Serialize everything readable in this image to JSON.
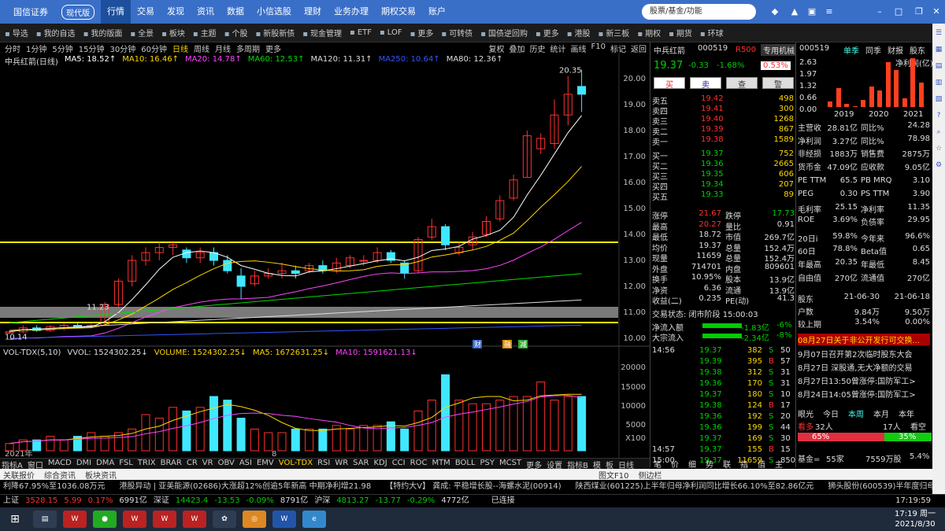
{
  "titlebar": {
    "logo": "国信证券",
    "edition": "现代版",
    "tabs": [
      "行情",
      "交易",
      "发现",
      "资讯",
      "数据",
      "小信选股",
      "理财",
      "业务办理",
      "期权交易",
      "账户"
    ],
    "search_placeholder": "股票/基金/功能"
  },
  "toolbar": [
    "导选",
    "我的自选",
    "我的版面",
    "全景",
    "板块",
    "主题",
    "个股",
    "新股新债",
    "现金管理",
    "ETF",
    "LOF",
    "更多",
    "可转债",
    "国债逆回购",
    "更多",
    "港股",
    "新三板",
    "期权",
    "期货",
    "环球"
  ],
  "periods": [
    "分时",
    "1分钟",
    "5分钟",
    "15分钟",
    "30分钟",
    "60分钟",
    "日线",
    "周线",
    "月线",
    "多周期",
    "更多"
  ],
  "chart_controls": [
    "复权",
    "叠加",
    "历史",
    "统计",
    "画线",
    "F10",
    "标记",
    "返回"
  ],
  "chart_title": "中兵红箭(日线)",
  "ma": [
    {
      "label": "MA5: 18.52↑",
      "color": "#ffffff"
    },
    {
      "label": "MA10: 16.46↑",
      "color": "#ffd700"
    },
    {
      "label": "MA20: 14.78↑",
      "color": "#ff44ff"
    },
    {
      "label": "MA60: 12.53↑",
      "color": "#00dd00"
    },
    {
      "label": "MA120: 11.31↑",
      "color": "#dddddd"
    },
    {
      "label": "MA250: 10.64↑",
      "color": "#3355ff"
    },
    {
      "label": "MA80: 12.36↑",
      "color": "#dddddd"
    }
  ],
  "vol": [
    {
      "label": "VOL-TDX(5,10)",
      "color": "#dddddd"
    },
    {
      "label": "VVOL: 1524302.25↓",
      "color": "#dddddd"
    },
    {
      "label": "VOLUME: 1524302.25↓",
      "color": "#ffd700"
    },
    {
      "label": "MA5: 1672631.25↓",
      "color": "#ffd700"
    },
    {
      "label": "MA10: 1591621.13↓",
      "color": "#ff44ff"
    }
  ],
  "price_axis": [
    "20.00",
    "19.00",
    "18.00",
    "17.00",
    "16.00",
    "15.00",
    "14.00",
    "13.00",
    "12.00",
    "11.00",
    "10.00"
  ],
  "vol_axis": [
    "20000",
    "15000",
    "10000",
    "5000",
    "X100"
  ],
  "annotations": {
    "high": "20.35",
    "low": "10.14",
    "mid": "11.23",
    "year": "2021年",
    "month": "8",
    "badges": [
      "财",
      "融",
      "减"
    ]
  },
  "indicators": [
    "指标A",
    "窗口",
    "MACD",
    "DMI",
    "DMA",
    "FSL",
    "TRIX",
    "BRAR",
    "CR",
    "VR",
    "OBV",
    "ASI",
    "EMV",
    "VOL-TDX",
    "RSI",
    "WR",
    "SAR",
    "KDJ",
    "CCI",
    "ROC",
    "MTM",
    "BOLL",
    "PSY",
    "MCST",
    "更多",
    "设置",
    "指标B",
    "模",
    "板",
    "日线"
  ],
  "quote": {
    "name": "中兵红箭",
    "code": "000519",
    "badge": "R500",
    "tag": "专用机械",
    "price": "19.37",
    "change": "-0.33",
    "pct": "-1.68%",
    "pct_box": "0.53%",
    "actions": [
      "买",
      "卖",
      "查",
      "警"
    ],
    "asks": [
      [
        "卖五",
        "19.42",
        "498"
      ],
      [
        "卖四",
        "19.41",
        "300"
      ],
      [
        "卖三",
        "19.40",
        "1268"
      ],
      [
        "卖二",
        "19.39",
        "867"
      ],
      [
        "卖一",
        "19.38",
        "1589"
      ]
    ],
    "bids": [
      [
        "买一",
        "19.37",
        "752"
      ],
      [
        "买二",
        "19.36",
        "2665"
      ],
      [
        "买三",
        "19.35",
        "606"
      ],
      [
        "买四",
        "19.34",
        "207"
      ],
      [
        "买五",
        "19.33",
        "89"
      ]
    ],
    "stats": [
      [
        "涨停",
        "21.67",
        "跌停",
        "17.73"
      ],
      [
        "最高",
        "20.27",
        "量比",
        "0.91"
      ],
      [
        "最低",
        "18.72",
        "市值",
        "269.7亿"
      ],
      [
        "均价",
        "19.37",
        "总量",
        "152.4万"
      ],
      [
        "现量",
        "11659",
        "总量",
        "152.4万"
      ],
      [
        "外盘",
        "714701",
        "内盘",
        "809601"
      ],
      [
        "换手",
        "10.95%",
        "股本",
        "13.9亿"
      ],
      [
        "净资",
        "6.36",
        "流通",
        "13.9亿"
      ],
      [
        "收益(二)",
        "0.235",
        "PE(动)",
        "41.3"
      ]
    ],
    "trade_status": "交易状态: 闭市阶段 15:00:03",
    "flows": [
      [
        "净流入额",
        "-1.83亿",
        "-6%"
      ],
      [
        "大宗流入",
        "-2.34亿",
        "-8%"
      ]
    ],
    "ticks": [
      [
        "14:56",
        "19.37",
        "382",
        "S",
        "50"
      ],
      [
        "",
        "19.39",
        "395",
        "B",
        "57"
      ],
      [
        "",
        "19.38",
        "312",
        "S",
        "31"
      ],
      [
        "",
        "19.36",
        "170",
        "S",
        "31"
      ],
      [
        "",
        "19.37",
        "180",
        "S",
        "10"
      ],
      [
        "",
        "19.38",
        "124",
        "B",
        "17"
      ],
      [
        "",
        "19.36",
        "192",
        "S",
        "20"
      ],
      [
        "",
        "19.36",
        "199",
        "S",
        "44"
      ],
      [
        "",
        "19.37",
        "169",
        "S",
        "30"
      ],
      [
        "14:57",
        "19.37",
        "155",
        "B",
        "15"
      ],
      [
        "15:00",
        "19.37",
        "11659",
        "S",
        "850"
      ]
    ],
    "tabs": [
      "笔",
      "价",
      "细",
      "势",
      "联",
      "指",
      "值",
      "主"
    ]
  },
  "fin": {
    "code": "000519",
    "tabs": [
      "单季",
      "同季",
      "财报",
      "股东"
    ],
    "chart_title": "净利润(亿)",
    "axis": [
      "2.63",
      "1.97",
      "1.32",
      "0.66",
      "0.00"
    ],
    "years": [
      "2019",
      "2020",
      "2021"
    ],
    "bars": [
      0.3,
      1.0,
      0.15,
      0.05,
      0.4,
      1.1,
      0.9,
      2.4,
      2.0,
      0.45,
      2.63,
      1.3
    ],
    "rows": [
      [
        "主营收",
        "28.81亿",
        "同比%",
        "24.28"
      ],
      [
        "净利润",
        "3.27亿",
        "同比%",
        "78.98"
      ],
      [
        "非经损",
        "1883万",
        "销售费",
        "2875万"
      ],
      [
        "货币金",
        "47.09亿",
        "应收款",
        "9.05亿"
      ],
      [
        "PE TTM",
        "65.5",
        "PB MRQ",
        "3.10"
      ],
      [
        "PEG",
        "0.30",
        "PS TTM",
        "3.90"
      ],
      [
        "毛利率",
        "25.15",
        "净利率",
        "11.35"
      ],
      [
        "ROE",
        "3.69%",
        "负债率",
        "29.95"
      ],
      [
        "20日i",
        "59.8%",
        "今年来",
        "96.6%"
      ],
      [
        "60日",
        "78.8%",
        "Beta值",
        "0.65"
      ],
      [
        "年最高",
        "20.35",
        "年最低",
        "8.45"
      ],
      [
        "自由值",
        "270亿",
        "流通值",
        "270亿"
      ]
    ],
    "holders": [
      [
        "股东",
        "21-06-30",
        "21-06-18"
      ],
      [
        "户数",
        "9.84万",
        "9.50万"
      ],
      [
        "较上期",
        "3.54%",
        "0.00%"
      ]
    ],
    "news_header": "08月27日关于非公开发行可交换...",
    "news": [
      "9月07日召开第2次临时股东大会",
      "8月27日 深股通,无大净额的交易",
      "8月27日13:50曾涨停:国防军工>",
      "8月24日14:05曾涨停:国防军工>"
    ],
    "sentiment_tabs": [
      "眼光",
      "今日",
      "本周",
      "本月",
      "本年"
    ],
    "sentiment_labels": [
      "看多",
      "32人",
      "17人",
      "看空"
    ],
    "bull": "65%",
    "bear": "35%",
    "fund": [
      "基金=",
      "55家",
      "7559万股",
      "5.4%"
    ],
    "bottom_tabs": [
      "日期",
      "增减持协议",
      "持股变动"
    ]
  },
  "bottom_links": [
    "关联报价",
    "综合资讯",
    "板块资讯",
    "图文F10",
    "侧边栏"
  ],
  "ticker": [
    "利降67.95%至1036.08万元",
    "港股异动 | 亚美能源(02686)大涨超12%创逾5年新高 中期净利增21.98",
    "【特约大V】 龚成: 平稳增长股--海螺水泥(00914)",
    "陕西煤业(601225)上半年归母净利润同比增长66.10%至82.86亿元",
    "狮头股份(600539)半年度归母净利同比增112"
  ],
  "index": [
    {
      "name": "上证",
      "val": "3528.15",
      "chg": "5.99",
      "pct": "0.17%",
      "amt": "6991亿",
      "up": true
    },
    {
      "name": "深证",
      "val": "14423.4",
      "chg": "-13.53",
      "pct": "-0.09%",
      "amt": "8791亿",
      "up": false
    },
    {
      "name": "沪深",
      "val": "4813.27",
      "chg": "-13.77",
      "pct": "-0.29%",
      "amt": "4772亿",
      "up": false
    }
  ],
  "connected": "已连接",
  "clock": "17:19:59",
  "taskbar_time": [
    "17:19 周一",
    "2021/8/30"
  ]
}
